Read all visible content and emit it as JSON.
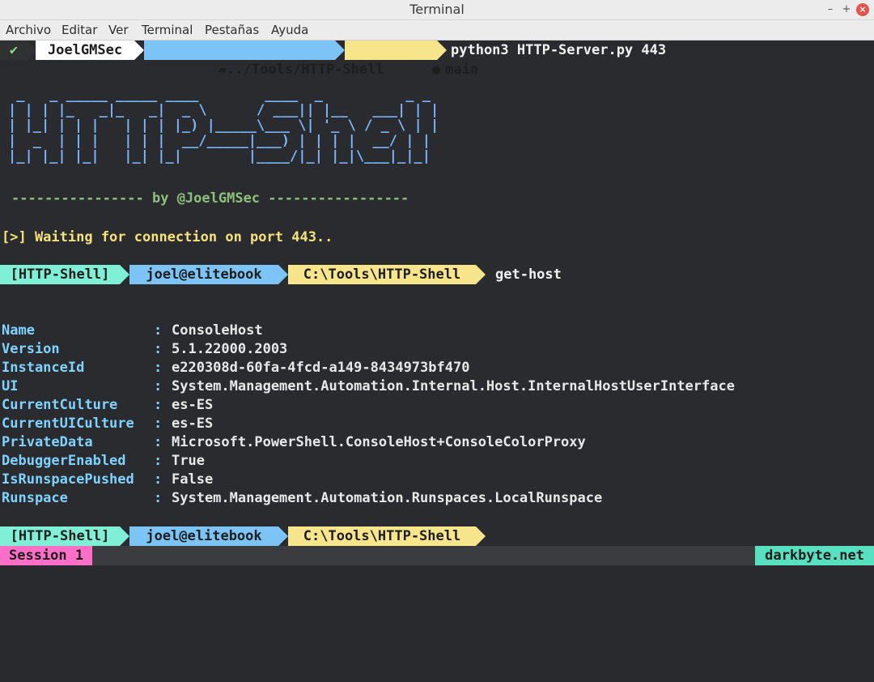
{
  "window": {
    "title": "Terminal",
    "min": "–",
    "max": "+",
    "close": "×"
  },
  "menu": [
    "Archivo",
    "Editar",
    "Ver",
    "Terminal",
    "Pestañas",
    "Ayuda"
  ],
  "prompt1": {
    "check": "✔",
    "user": "JoelGMSec",
    "path": "../Tools/HTTP-Shell",
    "branch": "main",
    "command": "python3 HTTP-Server.py 443"
  },
  "banner": {
    "ascii": " _   _ _____ _____ ____        ____  _          _ _ \n| | | |_   _|_   _|  _ \\      / ___|| |__   ___| | |\n| |_| | | |   | | | |_) |_____\\___ \\| '_ \\ / _ \\ | |\n|  _  | | |   | | |  __/_____|___) | | | |  __/ | |\n|_| |_| |_|   |_| |_|        |____/|_| |_|\\___|_|_|",
    "byline": "---------------- by @JoelGMSec -----------------"
  },
  "waiting": "[>] Waiting for connection on port 443..",
  "shell_prompt": {
    "tag": "[HTTP-Shell]",
    "host": "joel@elitebook",
    "path": "C:\\Tools\\HTTP-Shell",
    "command": "get-host"
  },
  "host_info": [
    {
      "key": "Name",
      "value": "ConsoleHost"
    },
    {
      "key": "Version",
      "value": "5.1.22000.2003"
    },
    {
      "key": "InstanceId",
      "value": "e220308d-60fa-4fcd-a149-8434973bf470"
    },
    {
      "key": "UI",
      "value": "System.Management.Automation.Internal.Host.InternalHostUserInterface"
    },
    {
      "key": "CurrentCulture",
      "value": "es-ES"
    },
    {
      "key": "CurrentUICulture",
      "value": "es-ES"
    },
    {
      "key": "PrivateData",
      "value": "Microsoft.PowerShell.ConsoleHost+ConsoleColorProxy"
    },
    {
      "key": "DebuggerEnabled",
      "value": "True"
    },
    {
      "key": "IsRunspacePushed",
      "value": "False"
    },
    {
      "key": "Runspace",
      "value": "System.Management.Automation.Runspaces.LocalRunspace"
    }
  ],
  "sep": ":",
  "status": {
    "session": "Session 1",
    "brand": "darkbyte.net"
  },
  "colors": {
    "check_bg": "#2f3133",
    "user_bg": "#ffffff",
    "path_bg": "#7cc4f5",
    "branch_bg": "#f7e58b",
    "tag_bg": "#7ff0d6",
    "host_bg": "#7cc4f5",
    "shellpath_bg": "#f7e58b",
    "session_bg": "#ff6ec7",
    "brand_bg": "#58e1c1"
  }
}
